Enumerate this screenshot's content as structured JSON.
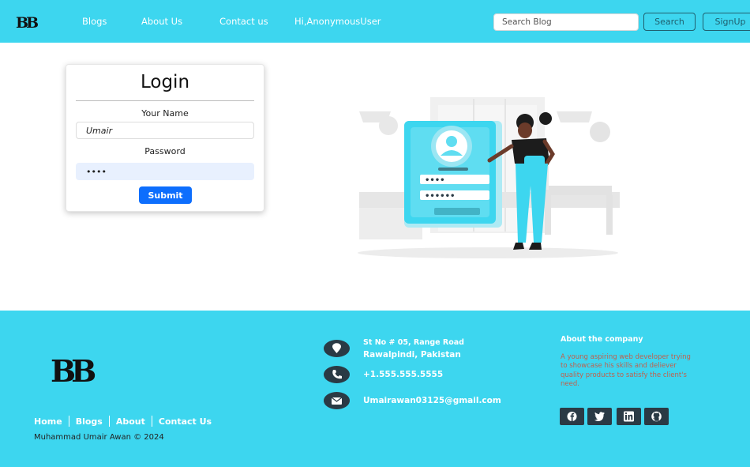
{
  "navbar": {
    "logo": "BB",
    "links": [
      "Blogs",
      "About Us",
      "Contact us"
    ],
    "greeting": "Hi,AnonymousUser",
    "search_placeholder": "Search Blog",
    "search_label": "Search",
    "signup_label": "SignUp",
    "background": "#3dd6ef"
  },
  "login": {
    "title": "Login",
    "name_label": "Your Name",
    "name_value": "Umair",
    "password_label": "Password",
    "password_value": "••••",
    "submit_label": "Submit",
    "submit_color": "#0d6efd"
  },
  "illustration": {
    "icon": "login-illustration",
    "password_dots_1": "••••",
    "password_dots_2": "••••••"
  },
  "footer": {
    "logo": "BB",
    "links": [
      "Home",
      "Blogs",
      "About",
      "Contact Us"
    ],
    "copyright": "Muhammad Umair Awan © 2024",
    "address_line1": "St No # 05, Range Road",
    "address_line2": "Rawalpindi, Pakistan",
    "phone": "+1.555.555.5555",
    "email": "Umairawan03125@gmail.com",
    "about_title": "About the company",
    "about_text": "A young aspiring web developer trying to showcase his skills and deliever quality products to satisfy the client's need.",
    "social_icons": [
      "facebook-icon",
      "twitter-icon",
      "linkedin-icon",
      "github-icon"
    ]
  }
}
